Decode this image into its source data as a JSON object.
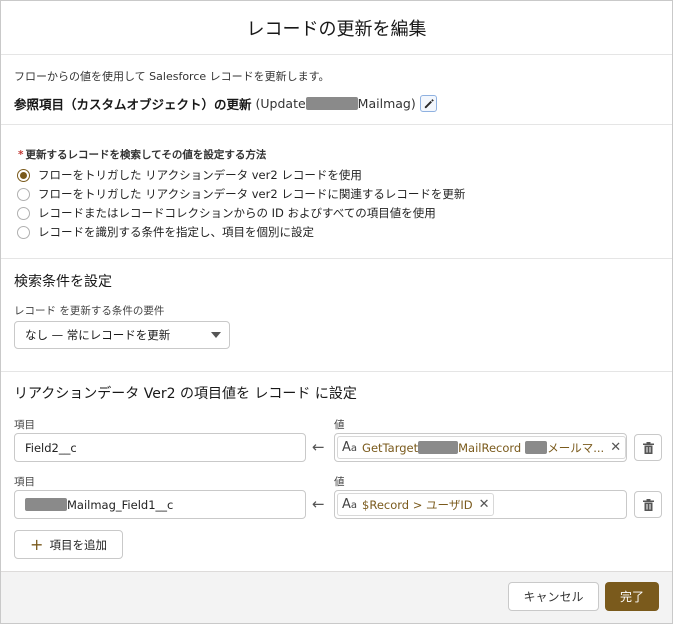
{
  "dialog": {
    "title": "レコードの更新を編集"
  },
  "element": {
    "description": "フローからの値を使用して Salesforce レコードを更新します。",
    "label": "参照項目（カスタムオブジェクト）の更新",
    "api_prefix": "(Update",
    "api_suffix": "Mailmag)",
    "edit_icon": "pencil-icon"
  },
  "method": {
    "required_mark": "*",
    "label": "更新するレコードを検索してその値を設定する方法",
    "options": [
      {
        "label": "フローをトリガした リアクションデータ ver2 レコードを使用",
        "selected": true
      },
      {
        "label": "フローをトリガした リアクションデータ ver2 レコードに関連するレコードを更新",
        "selected": false
      },
      {
        "label": "レコードまたはレコードコレクションからの ID およびすべての項目値を使用",
        "selected": false
      },
      {
        "label": "レコードを識別する条件を指定し、項目を個別に設定",
        "selected": false
      }
    ]
  },
  "filter": {
    "heading": "検索条件を設定",
    "requirement_label": "レコード を更新する条件の要件",
    "requirement_value": "なし — 常にレコードを更新"
  },
  "assignments": {
    "heading": "リアクションデータ Ver2 の項目値を レコード に設定",
    "field_label": "項目",
    "value_label": "値",
    "arrow": "←",
    "rows": [
      {
        "field": "Field2__c",
        "value_prefix": "GetTarget",
        "value_mid": "MailRecord",
        "value_suffix": "メールマ...",
        "value_icon": "text-type-icon"
      },
      {
        "field": "Mailmag_Field1__c",
        "value_full": "$Record > ユーザID",
        "value_icon": "text-type-icon"
      }
    ],
    "add_button": "項目を追加"
  },
  "footer": {
    "cancel": "キャンセル",
    "done": "完了"
  },
  "colors": {
    "brand": "#7a5a1c",
    "border": "#c9c9c9",
    "redaction": "#8a8a8a"
  }
}
